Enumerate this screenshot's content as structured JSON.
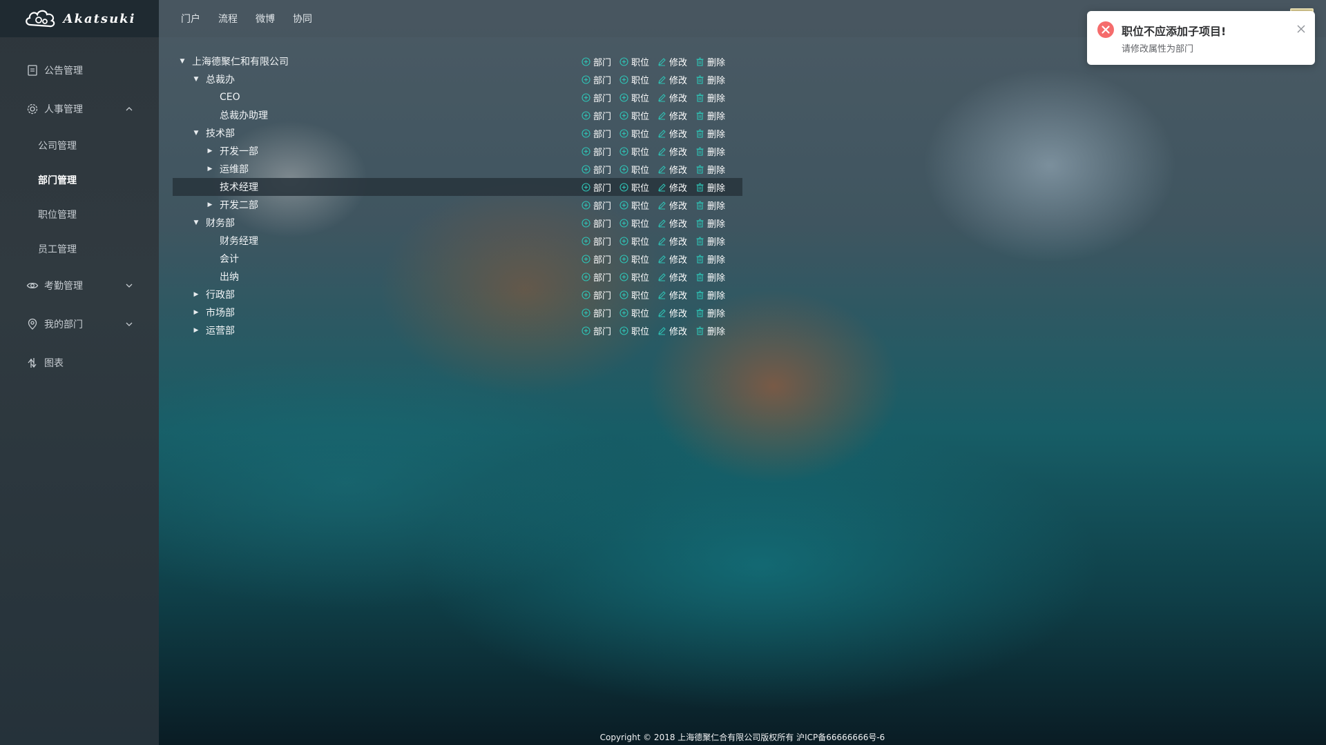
{
  "app": {
    "logo_text": "Akatsuki"
  },
  "topnav": {
    "items": [
      "门户",
      "流程",
      "微博",
      "协同"
    ]
  },
  "sidebar": {
    "menu": [
      {
        "label": "公告管理",
        "icon": "document-icon"
      },
      {
        "label": "人事管理",
        "icon": "gear-icon",
        "expanded": true,
        "children": [
          "公司管理",
          "部门管理",
          "职位管理",
          "员工管理"
        ],
        "active_child": "部门管理"
      },
      {
        "label": "考勤管理",
        "icon": "eye-icon",
        "expanded": false
      },
      {
        "label": "我的部门",
        "icon": "location-icon",
        "expanded": false
      },
      {
        "label": "图表",
        "icon": "chart-icon"
      }
    ]
  },
  "actions": {
    "add_dept": "部门",
    "add_position": "职位",
    "edit": "修改",
    "delete": "删除"
  },
  "tree": [
    {
      "label": "上海德聚仁和有限公司",
      "level": 0,
      "caret": "expanded"
    },
    {
      "label": "总裁办",
      "level": 1,
      "caret": "expanded"
    },
    {
      "label": "CEO",
      "level": 2,
      "caret": "none"
    },
    {
      "label": "总裁办助理",
      "level": 2,
      "caret": "none"
    },
    {
      "label": "技术部",
      "level": 1,
      "caret": "expanded"
    },
    {
      "label": "开发一部",
      "level": 2,
      "caret": "collapsed"
    },
    {
      "label": "运维部",
      "level": 2,
      "caret": "collapsed"
    },
    {
      "label": "技术经理",
      "level": 2,
      "caret": "none",
      "highlight": true
    },
    {
      "label": "开发二部",
      "level": 2,
      "caret": "collapsed"
    },
    {
      "label": "财务部",
      "level": 1,
      "caret": "expanded"
    },
    {
      "label": "财务经理",
      "level": 2,
      "caret": "none"
    },
    {
      "label": "会计",
      "level": 2,
      "caret": "none"
    },
    {
      "label": "出纳",
      "level": 2,
      "caret": "none"
    },
    {
      "label": "行政部",
      "level": 1,
      "caret": "collapsed"
    },
    {
      "label": "市场部",
      "level": 1,
      "caret": "collapsed"
    },
    {
      "label": "运营部",
      "level": 1,
      "caret": "collapsed"
    }
  ],
  "toast": {
    "title": "职位不应添加子项目!",
    "message": "请修改属性为部门",
    "type": "error",
    "color": "#f56c6c"
  },
  "footer": {
    "text": "Copyright © 2018 上海德聚仁合有限公司版权所有 沪ICP备66666666号-6"
  }
}
